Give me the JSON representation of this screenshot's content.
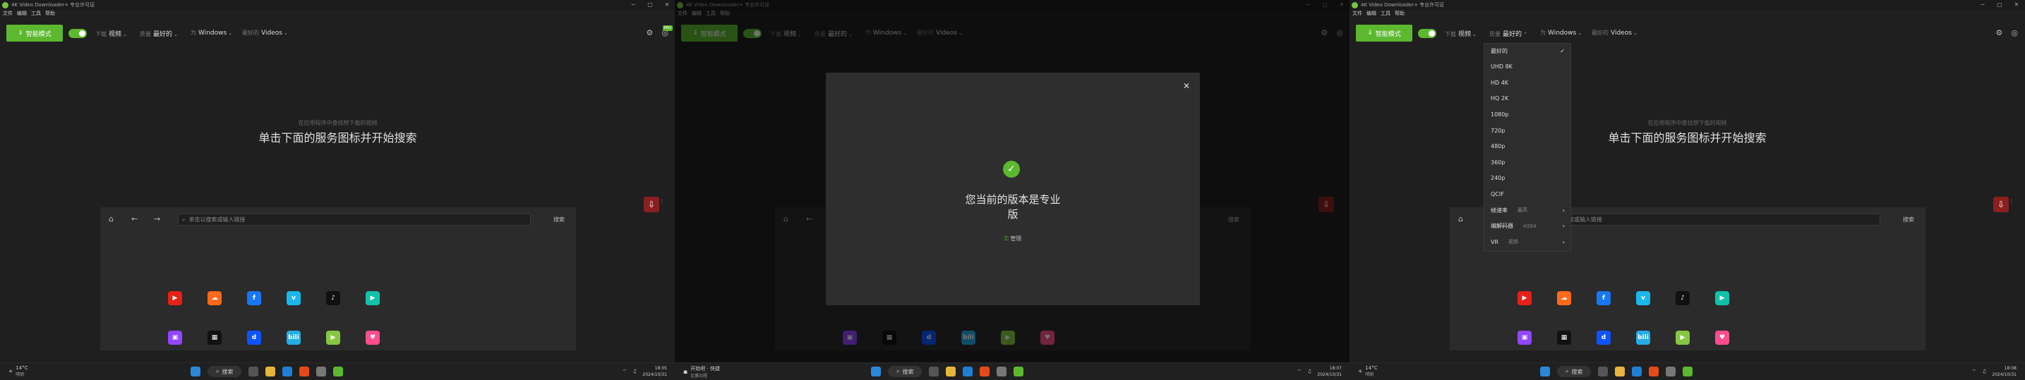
{
  "app": {
    "title": "4K Video Downloader+ 专业许可证",
    "menu": [
      "文件",
      "编辑",
      "工具",
      "帮助"
    ],
    "smart_mode_label": "智能模式",
    "options": [
      {
        "label": "下载",
        "value": "视频"
      },
      {
        "label": "质量",
        "value": "最好的"
      },
      {
        "label": "为",
        "value": "Windows"
      },
      {
        "label": "最好的",
        "value": "Videos"
      }
    ],
    "badge_text": "PRO",
    "hint_small": "在应用程序中查找想下载的视频",
    "hint_big": "单击下面的服务图标并开始搜索",
    "search_placeholder": "单击以搜索或输入链接",
    "search_button": "搜索",
    "services": [
      {
        "name": "youtube-icon",
        "glyph": "▶",
        "color": "#e62117"
      },
      {
        "name": "soundcloud-icon",
        "glyph": "☁",
        "color": "#ff6a1a"
      },
      {
        "name": "facebook-icon",
        "glyph": "f",
        "color": "#1877f2"
      },
      {
        "name": "vimeo-icon",
        "glyph": "v",
        "color": "#1ab7ea"
      },
      {
        "name": "tiktok-icon",
        "glyph": "♪",
        "color": "#111111"
      },
      {
        "name": "rumble-icon",
        "glyph": "▶",
        "color": "#12c2a8"
      },
      {
        "name": "twitch-icon",
        "glyph": "▣",
        "color": "#9146ff"
      },
      {
        "name": "niconico-icon",
        "glyph": "▦",
        "color": "#111111"
      },
      {
        "name": "dailymotion-icon",
        "glyph": "d",
        "color": "#0d54ff"
      },
      {
        "name": "bilibili-icon",
        "glyph": "bili",
        "color": "#23ade5"
      },
      {
        "name": "rumble2-icon",
        "glyph": "▶",
        "color": "#85c742"
      },
      {
        "name": "likee-icon",
        "glyph": "♥",
        "color": "#ff4d8d"
      }
    ]
  },
  "modal": {
    "message_line1": "您当前的版本是专业",
    "message_line2": "版",
    "manage_label": "管理"
  },
  "dropdown": {
    "items": [
      "最好的",
      "UHD 8K",
      "HD 4K",
      "HQ 2K",
      "1080p",
      "720p",
      "480p",
      "360p",
      "240p",
      "QCIF"
    ],
    "subitems": [
      {
        "label": "帧速率",
        "value": "最高"
      },
      {
        "label": "编解码器",
        "value": "H264"
      },
      {
        "label": "VR",
        "value": "视频"
      }
    ]
  },
  "taskbars": [
    {
      "weather_temp": "14°C",
      "weather_desc": "晴朗",
      "time": "18:05",
      "date": "2024/10/31"
    },
    {
      "weather_temp": "开始吧 · 快捷",
      "weather_desc": "比赛日程",
      "time": "18:07",
      "date": "2024/10/31"
    },
    {
      "weather_temp": "14°C",
      "weather_desc": "晴朗",
      "time": "18:08",
      "date": "2024/10/31"
    }
  ],
  "taskbar_search": "搜索"
}
